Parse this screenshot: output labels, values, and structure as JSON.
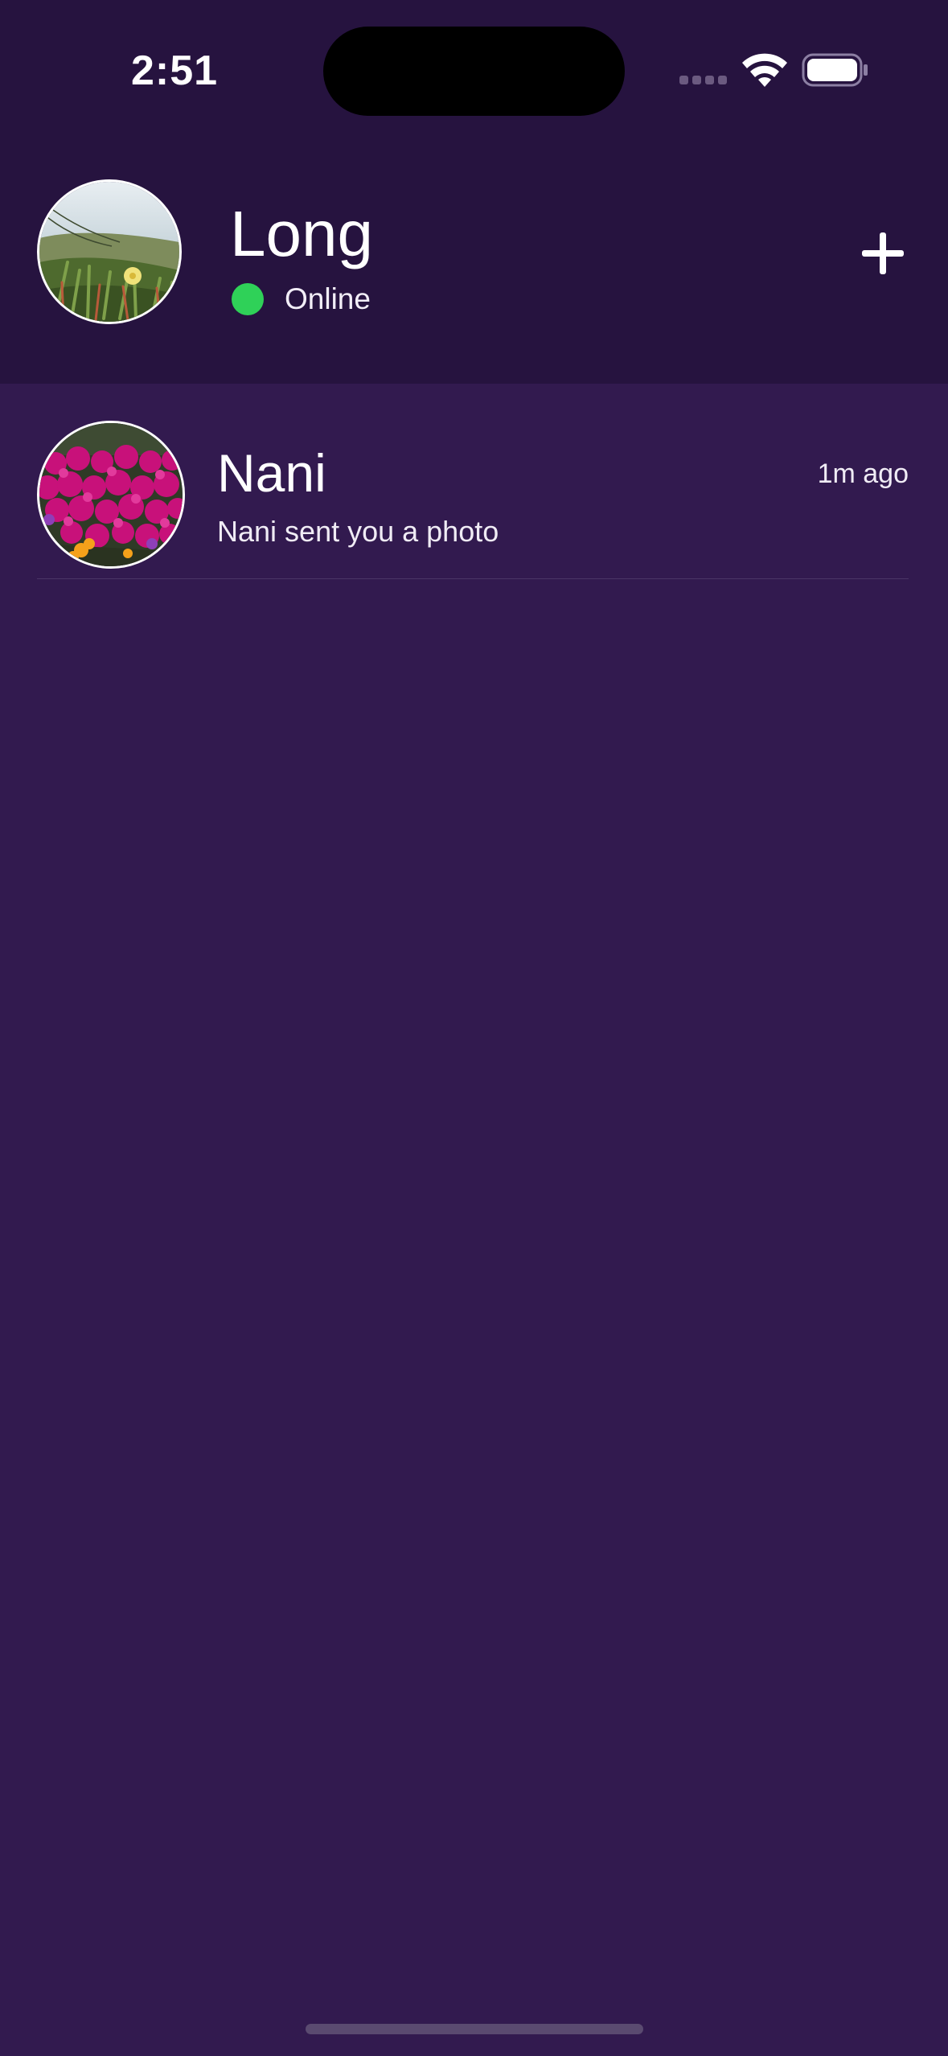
{
  "status_bar": {
    "time": "2:51",
    "signal_icon": "cellular-signal-icon",
    "wifi_icon": "wifi-icon",
    "battery_icon": "battery-icon"
  },
  "profile": {
    "name": "Long",
    "status_label": "Online",
    "status_color": "#2FD158",
    "avatar_icon": "profile-photo",
    "add_icon": "plus-icon"
  },
  "conversations": [
    {
      "name": "Nani",
      "time": "1m ago",
      "preview": "Nani sent you a photo",
      "avatar_icon": "contact-photo"
    }
  ],
  "colors": {
    "header_background": "#26133F",
    "list_background": "#321A4F",
    "text": "#FFFFFF",
    "online": "#2FD158"
  }
}
